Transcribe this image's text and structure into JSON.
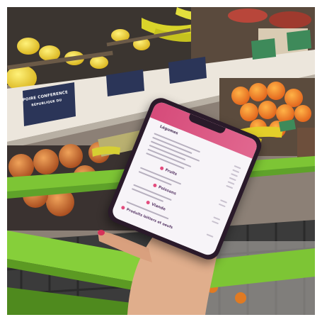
{
  "scene": {
    "shelf_labels": [
      "POIRE CONFERENCE",
      "RÉPUBLIQUE DU"
    ],
    "app": {
      "header": "Légumes",
      "categories": [
        {
          "label": "Fruits",
          "color": "#e34b7d"
        },
        {
          "label": "Poissons",
          "color": "#e34b7d"
        },
        {
          "label": "Viande",
          "color": "#e34b7d"
        },
        {
          "label": "Produits laitiers et oeufs",
          "color": "#e34b7d"
        }
      ]
    }
  }
}
